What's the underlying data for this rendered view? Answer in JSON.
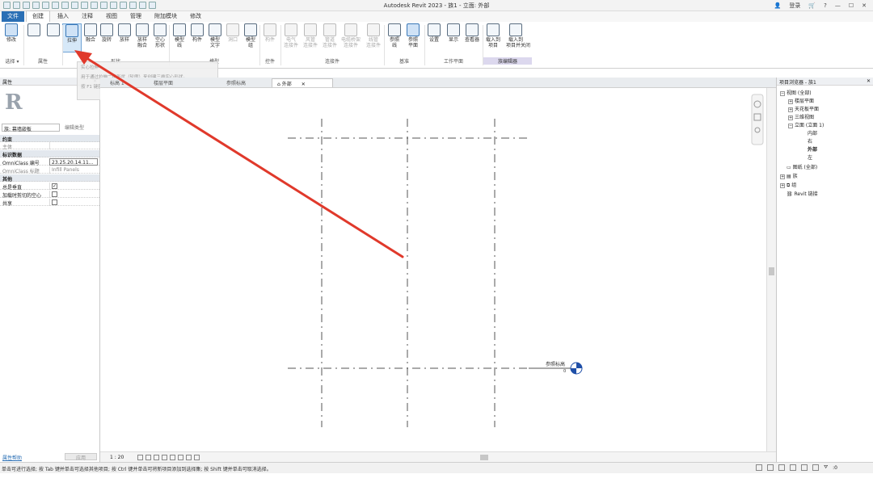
{
  "titlebar": {
    "title": "Autodesk Revit 2023 - 族1 - 立面: 外部",
    "user": "登录",
    "help": "?"
  },
  "ribbon_tabs": [
    "文件",
    "创建",
    "插入",
    "注释",
    "视图",
    "管理",
    "附加模块",
    "修改"
  ],
  "ribbon": {
    "tools": [
      {
        "label": "修改"
      },
      {
        "label": "拉伸"
      },
      {
        "label": "融合"
      },
      {
        "label": "旋转"
      },
      {
        "label": "放样"
      },
      {
        "label": "放样\n融合"
      },
      {
        "label": "空心\n形状"
      },
      {
        "label": "模型\n线"
      },
      {
        "label": "构件"
      },
      {
        "label": "模型\n文字"
      },
      {
        "label": "洞口"
      },
      {
        "label": "模型\n组"
      },
      {
        "label": "构件"
      },
      {
        "label": "电气\n连接件"
      },
      {
        "label": "风管\n连接件"
      },
      {
        "label": "管道\n连接件"
      },
      {
        "label": "电缆桥架\n连接件"
      },
      {
        "label": "线管\n连接件"
      },
      {
        "label": "参照\n线"
      },
      {
        "label": "参照\n平面"
      },
      {
        "label": "设置"
      },
      {
        "label": "显示"
      },
      {
        "label": "查看器"
      },
      {
        "label": "载入到\n项目"
      },
      {
        "label": "载入到\n项目并关闭"
      }
    ],
    "panels": {
      "select": "选择 ▾",
      "properties": "属性",
      "forms": "形状",
      "model": "模型",
      "control": "控件",
      "connectors": "连接件",
      "datum": "基准",
      "workplane": "工作平面",
      "family_editor": "族编辑器"
    }
  },
  "tooltip": {
    "line1": "实心拉伸",
    "line2": "用于通过拉伸二维形状（轮廓）来创建三维实心形状。",
    "line3": "按 F1 键获得更多帮助"
  },
  "properties": {
    "header": "属性",
    "type_selector": "族: 幕墙嵌板",
    "edit_type": "编辑类型",
    "sections": {
      "constraints": "约束",
      "host": "主体",
      "identity": "标识数据",
      "omni_num_label": "OmniClass 编号",
      "omni_num_value": "23.25.20.14.11...",
      "omni_title_label": "OmniClass 标题",
      "omni_title_value": "Infill Panels",
      "other": "其他",
      "always_vertical": "总是垂直",
      "cut_with_voids": "加载时剪切的空心",
      "shared": "共享"
    },
    "help": "属性帮助",
    "apply": "应用"
  },
  "view_tabs": [
    "标高 1",
    "楼层平面",
    "参照标高",
    "外部"
  ],
  "canvas": {
    "ref_level": "参照标高",
    "ref_level_value": "0"
  },
  "view_control": {
    "scale": "1 : 20"
  },
  "browser": {
    "header": "项目浏览器 - 族1",
    "items": [
      {
        "label": "视图 (全部)",
        "level": 0,
        "toggle": "−"
      },
      {
        "label": "楼层平面",
        "level": 1,
        "toggle": "+"
      },
      {
        "label": "天花板平面",
        "level": 1,
        "toggle": "+"
      },
      {
        "label": "三维视图",
        "level": 1,
        "toggle": "+"
      },
      {
        "label": "立面 (立面 1)",
        "level": 1,
        "toggle": "−"
      },
      {
        "label": "内部",
        "level": 2,
        "toggle": ""
      },
      {
        "label": "右",
        "level": 2,
        "toggle": ""
      },
      {
        "label": "外部",
        "level": 2,
        "toggle": ""
      },
      {
        "label": "左",
        "level": 2,
        "toggle": ""
      },
      {
        "label": "图纸 (全部)",
        "level": 0,
        "toggle": ""
      },
      {
        "label": "族",
        "level": 0,
        "toggle": "+"
      },
      {
        "label": "组",
        "level": 0,
        "toggle": "+"
      },
      {
        "label": "Revit 链接",
        "level": 0,
        "toggle": ""
      }
    ]
  },
  "status": {
    "message": "单击可进行选择; 按 Tab 键并单击可选择其他项目; 按 Ctrl 键并单击可将新项目添加到选择集; 按 Shift 键并单击可取消选择。",
    "filter_count": ":0"
  },
  "colors": {
    "file_tab": "#2a6fb5",
    "annotation_arrow": "#e0392b",
    "grid_dash": "#555555",
    "level_symbol": "#1f4fa8"
  }
}
